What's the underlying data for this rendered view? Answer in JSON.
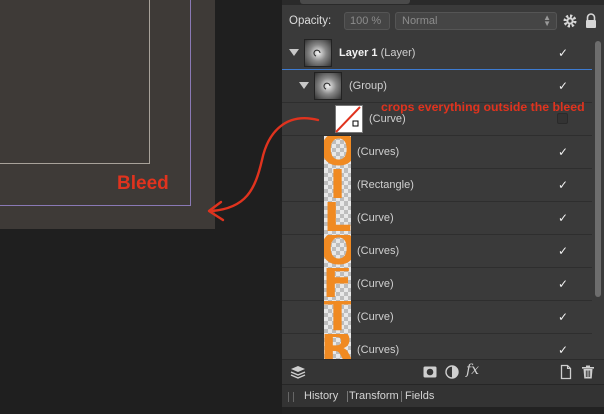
{
  "canvas": {
    "bleed_label": "Bleed"
  },
  "annotation": {
    "text": "crops everything outside the bleed",
    "color": "#e0331e"
  },
  "panel": {
    "opacity_label": "Opacity:",
    "opacity_value": "100 %",
    "blend_mode": "Normal",
    "icons": [
      "gear-icon",
      "lock-icon"
    ]
  },
  "layers": [
    {
      "indent": 0,
      "kind": "layer",
      "name": "Layer 1",
      "suffix": " (Layer)",
      "visible": true,
      "expanded": true,
      "thumb": "layer"
    },
    {
      "indent": 1,
      "kind": "group",
      "name": "(Group)",
      "visible": true,
      "expanded": true,
      "thumb": "layer"
    },
    {
      "indent": 2,
      "kind": "curve-mask",
      "name": "(Curve)",
      "visible": false,
      "thumb": "curve"
    },
    {
      "indent": 2,
      "kind": "letter",
      "name": "(Curves)",
      "visible": true,
      "letter": "O"
    },
    {
      "indent": 2,
      "kind": "letter",
      "name": "(Rectangle)",
      "visible": true,
      "letter": "I"
    },
    {
      "indent": 2,
      "kind": "letter",
      "name": "(Curve)",
      "visible": true,
      "letter": "L"
    },
    {
      "indent": 2,
      "kind": "letter",
      "name": "(Curves)",
      "visible": true,
      "letter": "O"
    },
    {
      "indent": 2,
      "kind": "letter",
      "name": "(Curve)",
      "visible": true,
      "letter": "F"
    },
    {
      "indent": 2,
      "kind": "letter",
      "name": "(Curve)",
      "visible": true,
      "letter": "T"
    },
    {
      "indent": 2,
      "kind": "letter",
      "name": "(Curves)",
      "visible": true,
      "letter": "R"
    }
  ],
  "toolbar": {
    "icons": [
      "layers-stack-icon",
      "mask-icon",
      "adjustment-icon",
      "fx-icon",
      "new-layer-icon",
      "trash-icon"
    ],
    "fx_label": "fx"
  },
  "tabs": [
    "History",
    "Transform",
    "Fields"
  ],
  "colors": {
    "accent": "#3d7bd1",
    "letter_orange": "#f08a22",
    "panel_bg": "#3a3a3a",
    "artboard_bg": "#3e3a37",
    "bleed_guide": "#8a79b5"
  }
}
